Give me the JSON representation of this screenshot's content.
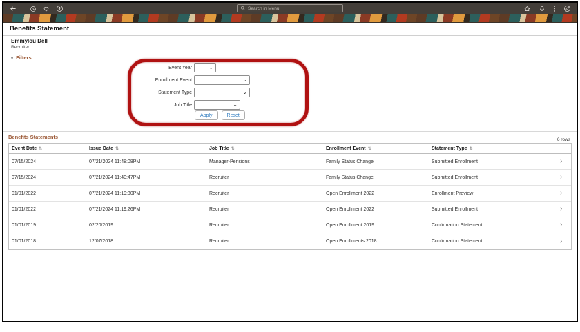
{
  "topbar": {
    "search_placeholder": "Search in Menu",
    "left_icons": [
      "back-icon",
      "recents-clock-icon",
      "favorites-heart-icon",
      "accessibility-icon"
    ],
    "right_icons": [
      "home-icon",
      "notifications-bell-icon",
      "actions-kebab-icon",
      "navbar-compass-icon"
    ]
  },
  "page": {
    "title": "Benefits Statement"
  },
  "person": {
    "name": "Emmylou Dell",
    "role": "Recruiter"
  },
  "filters": {
    "section_label": "Filters",
    "fields": [
      {
        "label": "Event Year",
        "value": ""
      },
      {
        "label": "Enrollment Event",
        "value": ""
      },
      {
        "label": "Statement Type",
        "value": ""
      },
      {
        "label": "Job Title",
        "value": ""
      }
    ],
    "apply_label": "Apply",
    "reset_label": "Reset"
  },
  "statements": {
    "section_label": "Benefits Statements",
    "row_count_label": "6 rows",
    "columns": [
      "Event Date",
      "Issue Date",
      "Job Title",
      "Enrollment Event",
      "Statement Type"
    ],
    "rows": [
      {
        "event_date": "07/15/2024",
        "issue_date": "07/21/2024 11:48:08PM",
        "job_title": "Manager-Pensions",
        "enrollment_event": "Family Status Change",
        "statement_type": "Submitted Enrollment"
      },
      {
        "event_date": "07/15/2024",
        "issue_date": "07/21/2024 11:40:47PM",
        "job_title": "Recruiter",
        "enrollment_event": "Family Status Change",
        "statement_type": "Submitted Enrollment"
      },
      {
        "event_date": "01/01/2022",
        "issue_date": "07/21/2024 11:19:30PM",
        "job_title": "Recruiter",
        "enrollment_event": "Open Enrollment 2022",
        "statement_type": "Enrollment Preview"
      },
      {
        "event_date": "01/01/2022",
        "issue_date": "07/21/2024 11:19:26PM",
        "job_title": "Recruiter",
        "enrollment_event": "Open Enrollment 2022",
        "statement_type": "Submitted Enrollment"
      },
      {
        "event_date": "01/01/2019",
        "issue_date": "02/20/2019",
        "job_title": "Recruiter",
        "enrollment_event": "Open Enrollment 2019",
        "statement_type": "Confirmation Statement"
      },
      {
        "event_date": "01/01/2018",
        "issue_date": "12/07/2018",
        "job_title": "Recruiter",
        "enrollment_event": "Open Enrollments 2018",
        "statement_type": "Confirmation Statement"
      }
    ]
  },
  "icons": {
    "sort_glyph": "⇅",
    "select_chevron": "⌄",
    "row_chevron": "›",
    "filters_chevron": "∨"
  },
  "colors": {
    "topbar_bg": "#433e39",
    "section_heading": "#9c5a38",
    "button_link_blue": "#2f7cc0",
    "annotation_red": "#b01212"
  }
}
